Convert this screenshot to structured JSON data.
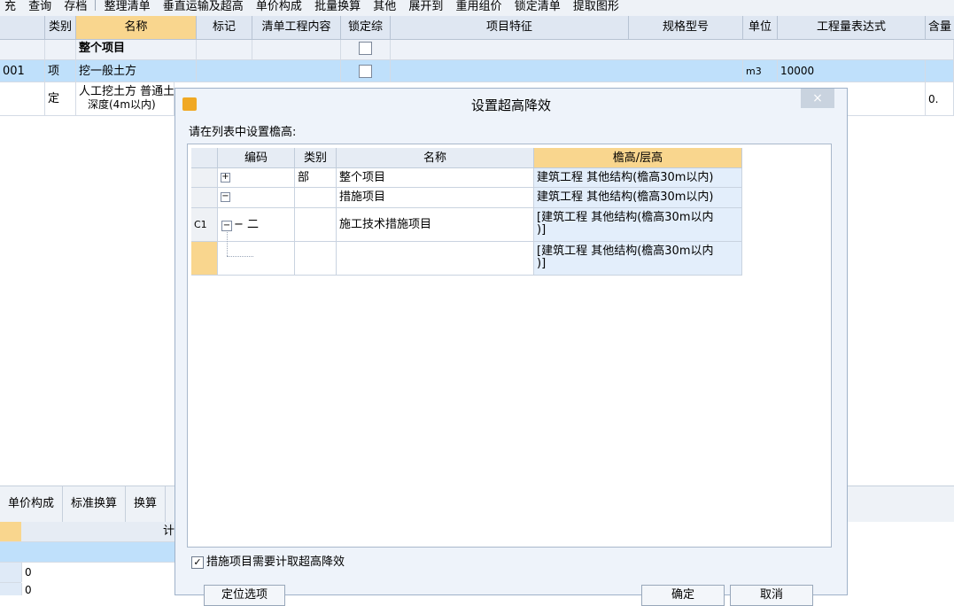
{
  "toolbar": {
    "items": [
      "充",
      "查询",
      "存档",
      "整理清单",
      "垂直运输及超高",
      "单价构成",
      "批量换算",
      "其他",
      "展开到",
      "重用组价",
      "锁定清单",
      "提取图形"
    ]
  },
  "grid": {
    "headers": [
      "类别",
      "名称",
      "标记",
      "清单工程内容",
      "锁定综",
      "项目特征",
      "规格型号",
      "单位",
      "工程量表达式",
      "含量"
    ],
    "rows": [
      {
        "code": "",
        "type": "",
        "name": "整个项目",
        "unit": "",
        "expr": "",
        "qty": ""
      },
      {
        "code": "001",
        "type": "项",
        "name": "挖一般土方",
        "unit": "m3",
        "expr": "10000",
        "qty": ""
      },
      {
        "code": "",
        "type": "定",
        "name": "人工挖土方 普通土",
        "name2": "深度(4m以内)",
        "unit": "",
        "expr": "",
        "qty": "0."
      }
    ]
  },
  "bottom": {
    "tabs": [
      "单价构成",
      "标准换算",
      "换算"
    ],
    "header": "计",
    "values": [
      "0",
      "0"
    ]
  },
  "dialog": {
    "title": "设置超高降效",
    "close": "×",
    "prompt": "请在列表中设置檐高:",
    "columns": [
      "编码",
      "类别",
      "名称",
      "檐高/层高"
    ],
    "rows": [
      {
        "rowhead": "",
        "code": "+",
        "type": "部",
        "name": "整个项目",
        "height": "建筑工程 其他结构(檐高30m以内)"
      },
      {
        "rowhead": "",
        "code": "−",
        "type": "",
        "name": "措施项目",
        "height": "建筑工程 其他结构(檐高30m以内)"
      },
      {
        "rowhead": "C1",
        "code": "− 二",
        "type": "",
        "name": "施工技术措施项目",
        "height": "[建筑工程 其他结构(檐高30m以内",
        "height2": ")]"
      },
      {
        "rowhead": "",
        "code": "",
        "type": "",
        "name": "",
        "height": "[建筑工程 其他结构(檐高30m以内",
        "height2": ")]"
      }
    ],
    "checkbox_label": "措施项目需要计取超高降效",
    "checkbox_mark": "✓",
    "buttons": {
      "locate": "定位选项",
      "ok": "确定",
      "cancel": "取消"
    }
  }
}
